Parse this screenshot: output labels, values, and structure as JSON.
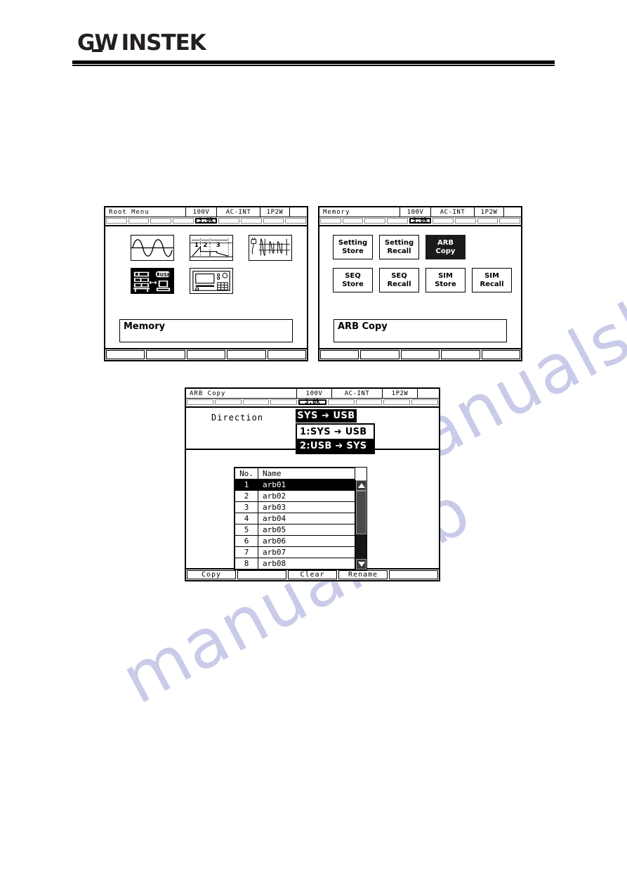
{
  "brand": {
    "logo_gw": "GW",
    "logo_instek": "INSTEK"
  },
  "watermark": {
    "line1": "manualslib.com",
    "line2": "manualslib"
  },
  "panels": {
    "root_menu": {
      "status": {
        "title": "Root Menu",
        "voltage": "100V",
        "mode": "AC-INT",
        "wiring": "1P2W",
        "spare": ""
      },
      "subbar": {
        "slots": [
          "",
          "",
          "",
          "",
          "3.0k",
          "",
          "",
          "",
          ""
        ],
        "active_index": 4
      },
      "icons": [
        {
          "name": "continuous-icon",
          "selected": false
        },
        {
          "name": "sequence-icon",
          "selected": false
        },
        {
          "name": "simulation-icon",
          "selected": false
        },
        {
          "name": "memory-icon",
          "selected": true
        },
        {
          "name": "system-icon",
          "selected": false
        }
      ],
      "info_label": "Memory",
      "fkeys": [
        "",
        "",
        "",
        "",
        ""
      ]
    },
    "memory": {
      "status": {
        "title": "Memory",
        "voltage": "100V",
        "mode": "AC-INT",
        "wiring": "1P2W",
        "spare": ""
      },
      "subbar": {
        "slots": [
          "",
          "",
          "",
          "",
          "3.0k",
          "",
          "",
          "",
          ""
        ],
        "active_index": 4
      },
      "buttons": [
        {
          "line1": "Setting",
          "line2": "Store",
          "selected": false
        },
        {
          "line1": "Setting",
          "line2": "Recall",
          "selected": false
        },
        {
          "line1": "ARB",
          "line2": "Copy",
          "selected": true
        },
        {
          "line1": "SEQ",
          "line2": "Store",
          "selected": false
        },
        {
          "line1": "SEQ",
          "line2": "Recall",
          "selected": false
        },
        {
          "line1": "SIM",
          "line2": "Store",
          "selected": false
        },
        {
          "line1": "SIM",
          "line2": "Recall",
          "selected": false
        }
      ],
      "info_label": "ARB Copy",
      "fkeys": [
        "",
        "",
        "",
        "",
        ""
      ]
    },
    "arb_copy": {
      "status": {
        "title": "ARB Copy",
        "voltage": "100V",
        "mode": "AC-INT",
        "wiring": "1P2W",
        "spare": ""
      },
      "subbar": {
        "slots": [
          "",
          "",
          "",
          "",
          "3.0k",
          "",
          "",
          "",
          ""
        ],
        "active_index": 4
      },
      "direction": {
        "label": "Direction",
        "value": "SYS ➔ USB",
        "options": [
          {
            "text": "1:SYS ➔ USB",
            "selected": false
          },
          {
            "text": "2:USB ➔ SYS",
            "selected": true
          }
        ]
      },
      "table": {
        "headers": {
          "no": "No.",
          "name": "Name"
        },
        "rows": [
          {
            "no": "1",
            "name": "arb01",
            "selected": true
          },
          {
            "no": "2",
            "name": "arb02",
            "selected": false
          },
          {
            "no": "3",
            "name": "arb03",
            "selected": false
          },
          {
            "no": "4",
            "name": "arb04",
            "selected": false
          },
          {
            "no": "5",
            "name": "arb05",
            "selected": false
          },
          {
            "no": "6",
            "name": "arb06",
            "selected": false
          },
          {
            "no": "7",
            "name": "arb07",
            "selected": false
          },
          {
            "no": "8",
            "name": "arb08",
            "selected": false
          }
        ]
      },
      "fkeys": [
        "Copy",
        "",
        "Clear",
        "Rename",
        ""
      ]
    }
  },
  "colors": {
    "ink": "#000000",
    "paper": "#ffffff",
    "selected_fill": "#1b1b1b",
    "watermark": "#c9cbe9"
  }
}
